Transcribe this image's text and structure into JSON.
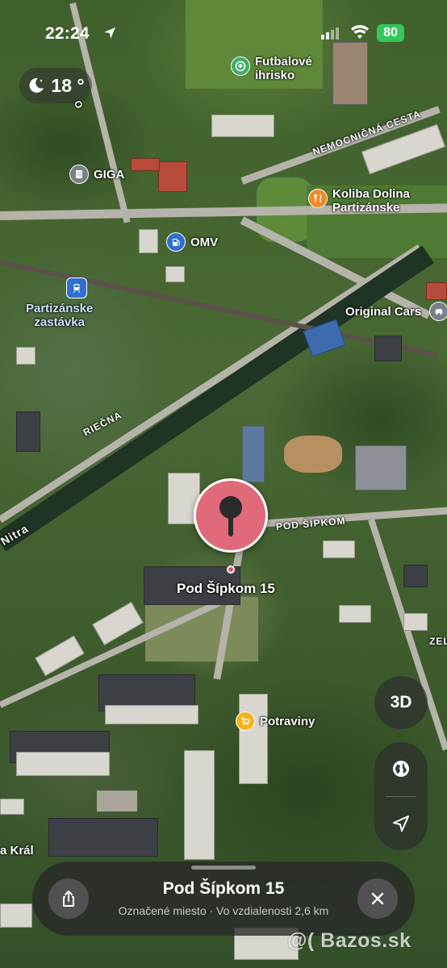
{
  "status_bar": {
    "time": "22:24",
    "battery": "80"
  },
  "weather": {
    "temperature": "18 °",
    "icon": "moon-stars-icon"
  },
  "map": {
    "places": [
      {
        "label": "Futbalové\nihrisko",
        "icon": "soccer-icon",
        "color": "#3fae6a"
      },
      {
        "label": "GIGA",
        "icon": "building-icon",
        "color": "#7a7f8a"
      },
      {
        "label": "Koliba Dolina\nPartizánske",
        "icon": "fork-knife-icon",
        "color": "#f08a24"
      },
      {
        "label": "OMV",
        "icon": "fuel-icon",
        "color": "#2f6fd0"
      },
      {
        "label": "Partizánske\nzastávka",
        "icon": "train-icon",
        "color": "#2f6fd0"
      },
      {
        "label": "Original Cars",
        "icon": "car-icon",
        "color": "#7a7f8a"
      },
      {
        "label": "Potraviny",
        "icon": "cart-icon",
        "color": "#f5b21c"
      }
    ],
    "streets": {
      "nemocnicna": "NEMOCNIČNÁ CESTA",
      "riecna": "RIEČNA",
      "pod_sipkom": "POD ŠÍPKOM",
      "nitra": "Nitra",
      "vertical_o": "O",
      "zel": "ZEL",
      "kral": "a Král"
    },
    "pin": {
      "label": "Pod Šípkom 15",
      "color": "#e0697a"
    }
  },
  "controls": {
    "three_d": "3D",
    "globe_icon": "globe-icon",
    "location_icon": "location-arrow-icon"
  },
  "sheet": {
    "title": "Pod Šípkom 15",
    "subtitle": "Označené miesto · Vo vzdialenosti 2,6 km",
    "share_icon": "share-icon",
    "close_icon": "close-icon"
  },
  "watermark": "@( Bazos.sk"
}
